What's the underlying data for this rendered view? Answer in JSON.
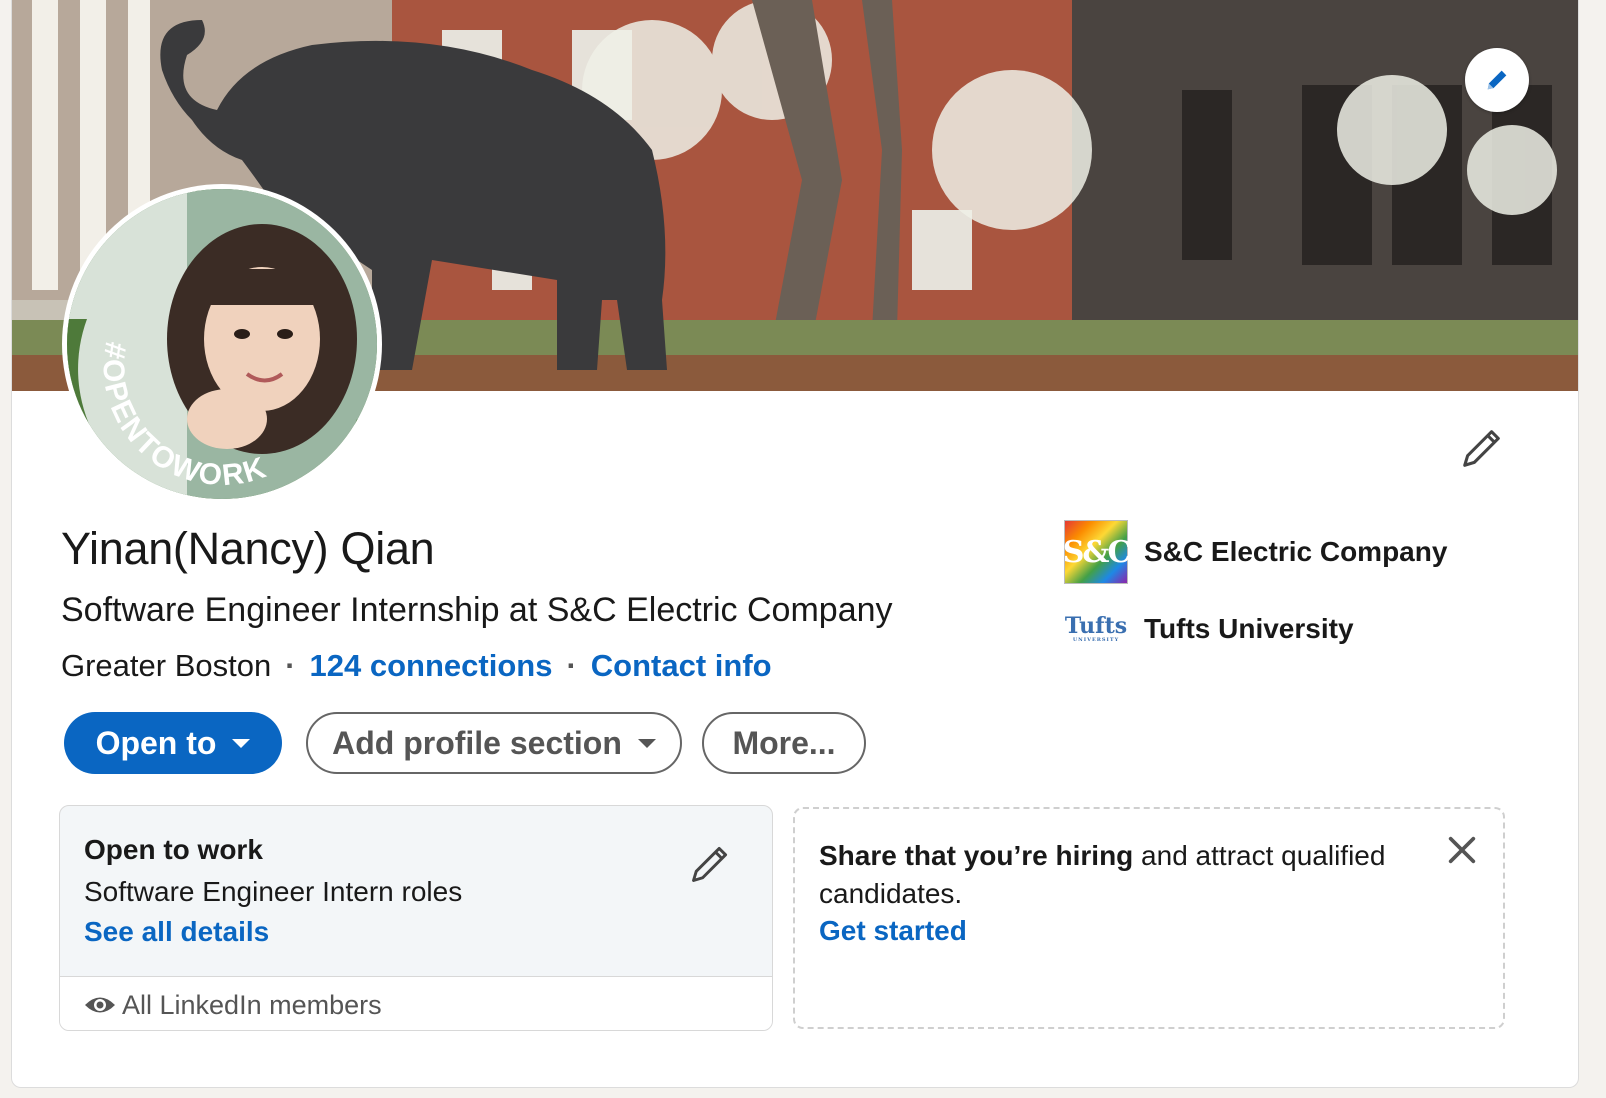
{
  "profile": {
    "name": "Yinan(Nancy) Qian",
    "headline": "Software Engineer Internship at S&C Electric Company",
    "location": "Greater Boston",
    "connections_link": "124 connections",
    "contact_link": "Contact info",
    "separator": "·",
    "avatar_badge": "#OPENTOWORK"
  },
  "right_column": {
    "company": "S&C Electric Company",
    "company_logo_text": "S&C",
    "school": "Tufts University",
    "school_logo_text": "Tufts",
    "school_logo_subtext": "UNIVERSITY"
  },
  "actions": {
    "open_to": "Open to",
    "add_section": "Add profile section",
    "more": "More..."
  },
  "open_to_work": {
    "title": "Open to work",
    "description": "Software Engineer Intern roles",
    "details_link": "See all details",
    "visibility": "All LinkedIn members"
  },
  "hiring": {
    "bold_text": "Share that you’re hiring",
    "rest_text": " and attract qualified candidates.",
    "cta": "Get started"
  },
  "colors": {
    "primary_blue": "#0a66c2",
    "otw_green": "#4e7a3a",
    "text_dark": "#191919",
    "text_muted": "#555555"
  },
  "icons": {
    "banner_edit": "pencil-icon",
    "intro_edit": "pencil-icon",
    "otw_edit": "pencil-icon",
    "visibility": "eye-icon",
    "dismiss": "close-icon",
    "dropdown": "caret-down-icon"
  }
}
